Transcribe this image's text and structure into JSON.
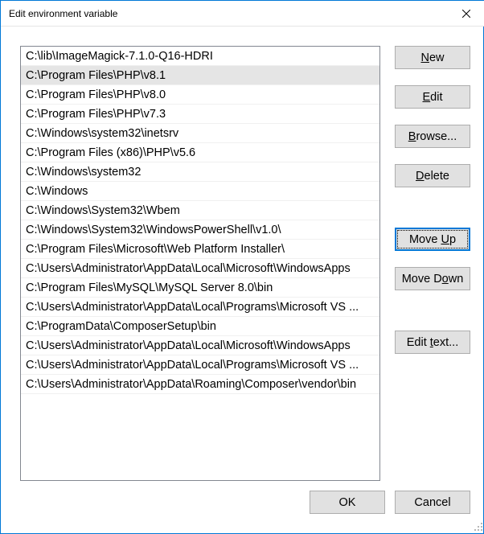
{
  "title": "Edit environment variable",
  "list": {
    "selectedIndex": 1,
    "items": [
      "C:\\lib\\ImageMagick-7.1.0-Q16-HDRI",
      "C:\\Program Files\\PHP\\v8.1",
      "C:\\Program Files\\PHP\\v8.0",
      "C:\\Program Files\\PHP\\v7.3",
      "C:\\Windows\\system32\\inetsrv",
      "C:\\Program Files (x86)\\PHP\\v5.6",
      "C:\\Windows\\system32",
      "C:\\Windows",
      "C:\\Windows\\System32\\Wbem",
      "C:\\Windows\\System32\\WindowsPowerShell\\v1.0\\",
      "C:\\Program Files\\Microsoft\\Web Platform Installer\\",
      "C:\\Users\\Administrator\\AppData\\Local\\Microsoft\\WindowsApps",
      "C:\\Program Files\\MySQL\\MySQL Server 8.0\\bin",
      "C:\\Users\\Administrator\\AppData\\Local\\Programs\\Microsoft VS ...",
      "C:\\ProgramData\\ComposerSetup\\bin",
      "C:\\Users\\Administrator\\AppData\\Local\\Microsoft\\WindowsApps",
      "C:\\Users\\Administrator\\AppData\\Local\\Programs\\Microsoft VS ...",
      "C:\\Users\\Administrator\\AppData\\Roaming\\Composer\\vendor\\bin"
    ]
  },
  "buttons": {
    "new": {
      "pre": "",
      "u": "N",
      "post": "ew"
    },
    "edit": {
      "pre": "",
      "u": "E",
      "post": "dit"
    },
    "browse": {
      "pre": "",
      "u": "B",
      "post": "rowse..."
    },
    "delete": {
      "pre": "",
      "u": "D",
      "post": "elete"
    },
    "moveUp": {
      "pre": "Move ",
      "u": "U",
      "post": "p"
    },
    "moveDown": {
      "pre": "Move D",
      "u": "o",
      "post": "wn"
    },
    "editText": {
      "pre": "Edit ",
      "u": "t",
      "post": "ext..."
    },
    "ok": "OK",
    "cancel": "Cancel"
  }
}
